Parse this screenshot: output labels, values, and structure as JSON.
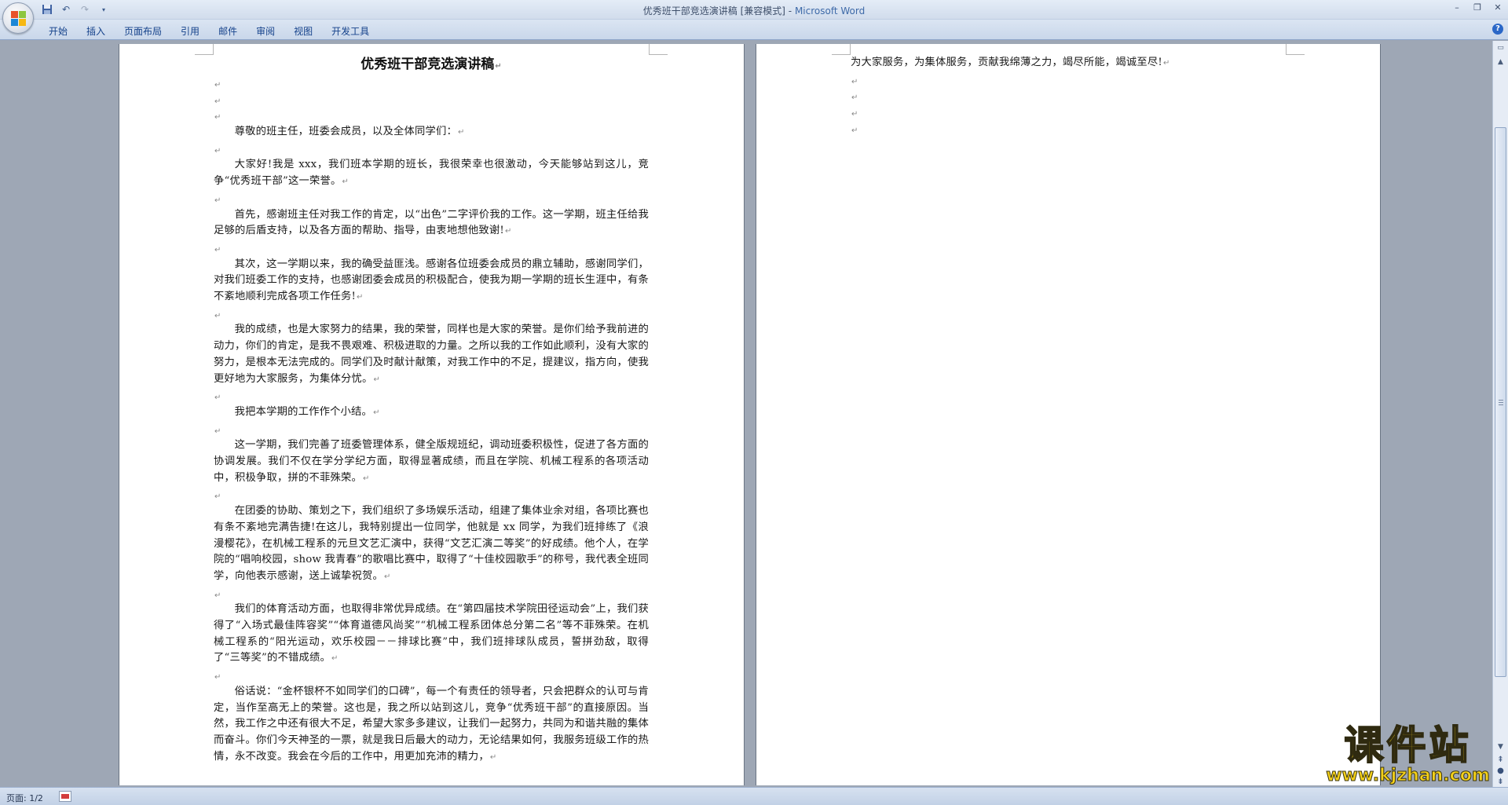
{
  "window": {
    "title": "优秀班干部竞选演讲稿 [兼容模式]",
    "app_name": "Microsoft Word",
    "title_separator": " - "
  },
  "quick_access": {
    "save_icon": "save-icon",
    "undo_icon": "undo-icon",
    "redo_icon": "redo-icon",
    "customize_icon": "customize-dropdown-icon"
  },
  "ribbon": {
    "tabs": [
      "开始",
      "插入",
      "页面布局",
      "引用",
      "邮件",
      "审阅",
      "视图",
      "开发工具"
    ]
  },
  "document": {
    "title": "优秀班干部竞选演讲稿",
    "page1": [
      {
        "type": "blank"
      },
      {
        "type": "blank"
      },
      {
        "type": "blank"
      },
      {
        "type": "text",
        "text": "尊敬的班主任，班委会成员，以及全体同学们："
      },
      {
        "type": "blank"
      },
      {
        "type": "text",
        "text": "大家好!我是 xxx，我们班本学期的班长，我很荣幸也很激动，今天能够站到这儿，竞争“优秀班干部”这一荣誉。"
      },
      {
        "type": "blank"
      },
      {
        "type": "text",
        "text": "首先，感谢班主任对我工作的肯定，以“出色”二字评价我的工作。这一学期，班主任给我足够的后盾支持，以及各方面的帮助、指导，由衷地想他致谢!"
      },
      {
        "type": "blank"
      },
      {
        "type": "text",
        "text": "其次，这一学期以来，我的确受益匪浅。感谢各位班委会成员的鼎立辅助，感谢同学们，对我们班委工作的支持，也感谢团委会成员的积极配合，使我为期一学期的班长生涯中，有条不紊地顺利完成各项工作任务!"
      },
      {
        "type": "blank"
      },
      {
        "type": "text",
        "text": "我的成绩，也是大家努力的结果，我的荣誉，同样也是大家的荣誉。是你们给予我前进的动力，你们的肯定，是我不畏艰难、积极进取的力量。之所以我的工作如此顺利，没有大家的努力，是根本无法完成的。同学们及时献计献策，对我工作中的不足，提建议，指方向，使我更好地为大家服务，为集体分忧。"
      },
      {
        "type": "blank"
      },
      {
        "type": "text",
        "text": "我把本学期的工作作个小结。"
      },
      {
        "type": "blank"
      },
      {
        "type": "text",
        "text": "这一学期，我们完善了班委管理体系，健全版规班纪，调动班委积极性，促进了各方面的协调发展。我们不仅在学分学纪方面，取得显著成绩，而且在学院、机械工程系的各项活动中，积极争取，拼的不菲殊荣。"
      },
      {
        "type": "blank"
      },
      {
        "type": "text",
        "text": "在团委的协助、策划之下，我们组织了多场娱乐活动，组建了集体业余对组，各项比赛也有条不紊地完满告捷!在这儿，我特别提出一位同学，他就是 xx 同学，为我们班排练了《浪漫樱花》，在机械工程系的元旦文艺汇演中，获得“文艺汇演二等奖”的好成绩。他个人，在学院的“唱响校园，show 我青春”的歌唱比赛中，取得了“十佳校园歌手”的称号，我代表全班同学，向他表示感谢，送上诚挚祝贺。"
      },
      {
        "type": "blank"
      },
      {
        "type": "text",
        "text": "我们的体育活动方面，也取得非常优异成绩。在“第四届技术学院田径运动会”上，我们获得了“入场式最佳阵容奖”“体育道德风尚奖”“机械工程系团体总分第二名”等不菲殊荣。在机械工程系的“阳光运动，欢乐校园－－排球比赛”中，我们班排球队成员，誓拼劲敌，取得了“三等奖”的不错成绩。"
      },
      {
        "type": "blank"
      },
      {
        "type": "text",
        "text": "俗话说：“金杯银杯不如同学们的口碑”，每一个有责任的领导者，只会把群众的认可与肯定，当作至高无上的荣誉。这也是，我之所以站到这儿，竞争“优秀班干部”的直接原因。当然，我工作之中还有很大不足，希望大家多多建议，让我们一起努力，共同为和谐共融的集体而奋斗。你们今天神圣的一票，就是我日后最大的动力，无论结果如何，我服务班级工作的热情，永不改变。我会在今后的工作中，用更加充沛的精力，"
      }
    ],
    "page2": [
      {
        "type": "text",
        "text": "为大家服务，为集体服务，贡献我绵薄之力，竭尽所能，竭诚至尽!"
      },
      {
        "type": "blank"
      },
      {
        "type": "blank"
      },
      {
        "type": "blank"
      },
      {
        "type": "blank"
      }
    ],
    "paragraph_mark": "↵"
  },
  "statusbar": {
    "page_info": "页面: 1/2"
  },
  "watermark": {
    "main": "课件站",
    "url": "www.kjzhan.com"
  }
}
